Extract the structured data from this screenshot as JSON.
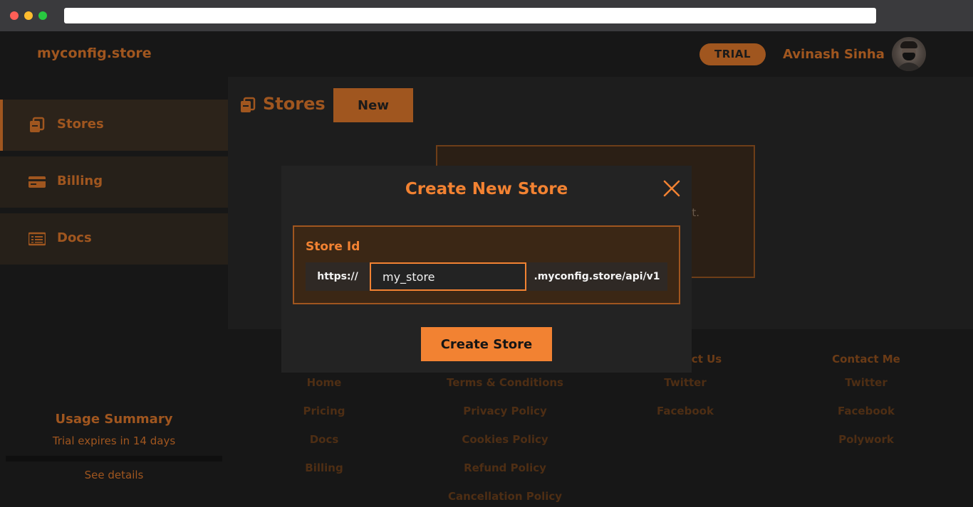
{
  "brand": "myconfig.store",
  "header": {
    "badge": "TRIAL",
    "user_name": "Avinash Sinha"
  },
  "sidebar": {
    "items": [
      {
        "label": "Stores",
        "icon": "stores-icon",
        "active": true
      },
      {
        "label": "Billing",
        "icon": "credit-card-icon",
        "active": false
      },
      {
        "label": "Docs",
        "icon": "docs-icon",
        "active": false
      }
    ]
  },
  "usage": {
    "title": "Usage Summary",
    "subtitle": "Trial expires in 14 days",
    "link": "See details"
  },
  "main": {
    "title": "Stores",
    "new_label": "New",
    "empty_card_fragment": "t."
  },
  "footer": {
    "columns": [
      {
        "heading": "",
        "links": [
          "Home",
          "Pricing",
          "Docs",
          "Billing"
        ]
      },
      {
        "heading": "",
        "links": [
          "Terms & Conditions",
          "Privacy Policy",
          "Cookies Policy",
          "Refund Policy",
          "Cancellation Policy"
        ]
      },
      {
        "heading": "ct Us",
        "links": [
          "Twitter",
          "Facebook"
        ]
      },
      {
        "heading": "Contact Me",
        "links": [
          "Twitter",
          "Facebook",
          "Polywork"
        ]
      }
    ]
  },
  "modal": {
    "title": "Create New Store",
    "field_label": "Store Id",
    "prefix": "https://",
    "input_value": "my_store",
    "suffix": ".myconfig.store/api/v1",
    "submit_label": "Create Store"
  },
  "colors": {
    "accent": "#f28232",
    "accent_dim": "#a0561f",
    "background": "#171717"
  }
}
